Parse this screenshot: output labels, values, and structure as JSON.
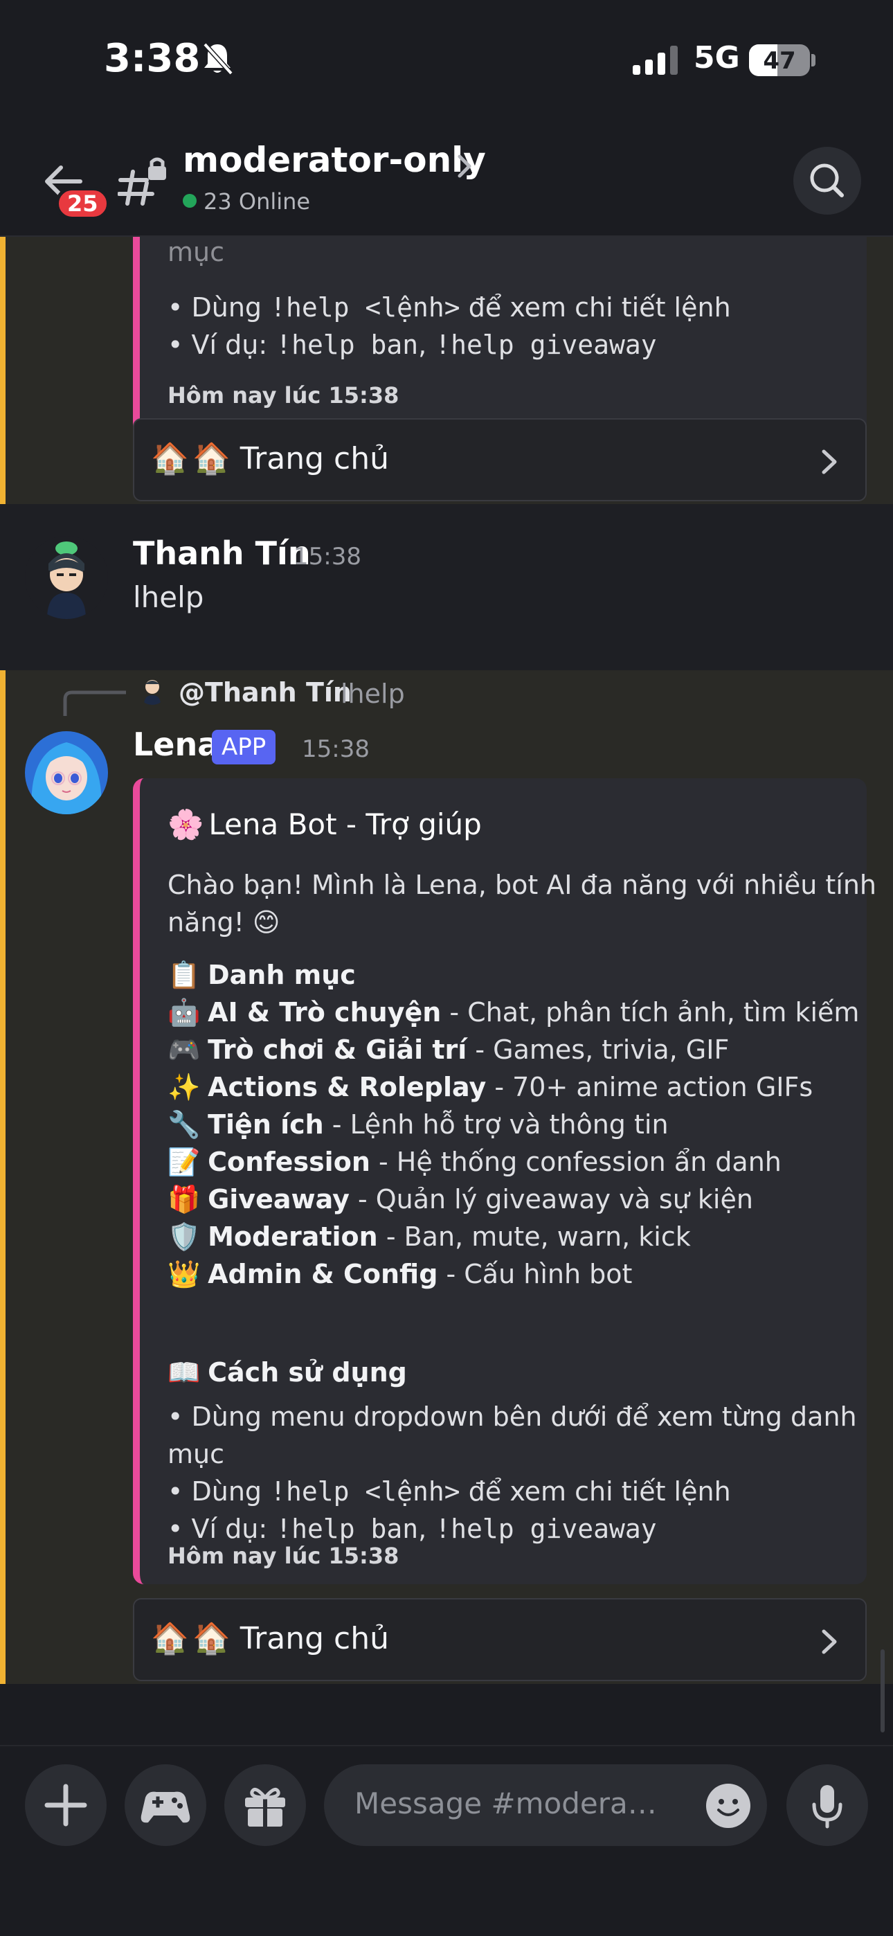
{
  "status_bar": {
    "time": "3:38",
    "network": "5G",
    "battery_percent": "47",
    "battery_level": 0.47
  },
  "header": {
    "channel_name": "moderator-only",
    "online_text": "23 Online",
    "unread_count": "25"
  },
  "top_embed": {
    "partial_line": "mục",
    "usage_lines": [
      {
        "pre": "• Dùng ",
        "code": "!help <lệnh>",
        "post": " để xem chi tiết lệnh"
      },
      {
        "pre": "• Ví dụ: ",
        "code1": "!help ban",
        "sep": ", ",
        "code2": "!help giveaway"
      }
    ],
    "footer": "Hôm nay lúc 15:38",
    "button_label": "🏠 Trang chủ"
  },
  "user_message": {
    "author": "Thanh Tín",
    "time": "15:38",
    "text": "lhelp"
  },
  "bot_message": {
    "reply_author": "@Thanh Tín",
    "reply_text": "lhelp",
    "author": "Lena",
    "app_tag": "APP",
    "time": "15:38",
    "embed": {
      "title": "Lena Bot - Trợ giúp",
      "intro_line1": "Chào bạn! Mình là Lena, bot AI đa năng với nhiều tính",
      "intro_line2": "năng! 😊",
      "categories_heading": "Danh mục",
      "categories": [
        {
          "icon": "🤖",
          "name": "AI & Trò chuyện",
          "desc": " - Chat, phân tích ảnh, tìm kiếm"
        },
        {
          "icon": "🎮",
          "name": "Trò chơi & Giải trí",
          "desc": " - Games, trivia, GIF"
        },
        {
          "icon": "✨",
          "name": "Actions & Roleplay",
          "desc": " - 70+ anime action GIFs"
        },
        {
          "icon": "🔧",
          "name": "Tiện ích",
          "desc": " - Lệnh hỗ trợ và thông tin"
        },
        {
          "icon": "📝",
          "name": "Confession",
          "desc": " - Hệ thống confession ẩn danh"
        },
        {
          "icon": "🎁",
          "name": "Giveaway",
          "desc": " - Quản lý giveaway và sự kiện"
        },
        {
          "icon": "🛡️",
          "name": "Moderation",
          "desc": " - Ban, mute, warn, kick"
        },
        {
          "icon": "👑",
          "name": "Admin & Config",
          "desc": " - Cấu hình bot"
        }
      ],
      "usage_heading": "Cách sử dụng",
      "usage_line1a": "• Dùng menu dropdown bên dưới để xem từng danh",
      "usage_line1b": "mục",
      "usage_line2_pre": "• Dùng ",
      "usage_line2_code": "!help <lệnh>",
      "usage_line2_post": " để xem chi tiết lệnh",
      "usage_line3_pre": "• Ví dụ: ",
      "usage_line3_code1": "!help ban",
      "usage_line3_sep": ", ",
      "usage_line3_code2": "!help giveaway",
      "footer": "Hôm nay lúc 15:38"
    },
    "button_label": "🏠 Trang chủ"
  },
  "composer": {
    "placeholder": "Message #moderator-only"
  },
  "colors": {
    "accent_highlight": "#f0b232",
    "embed_bar": "#e94a9a",
    "app_tag": "#5865f2",
    "online": "#23a55a",
    "badge": "#e8393f"
  }
}
